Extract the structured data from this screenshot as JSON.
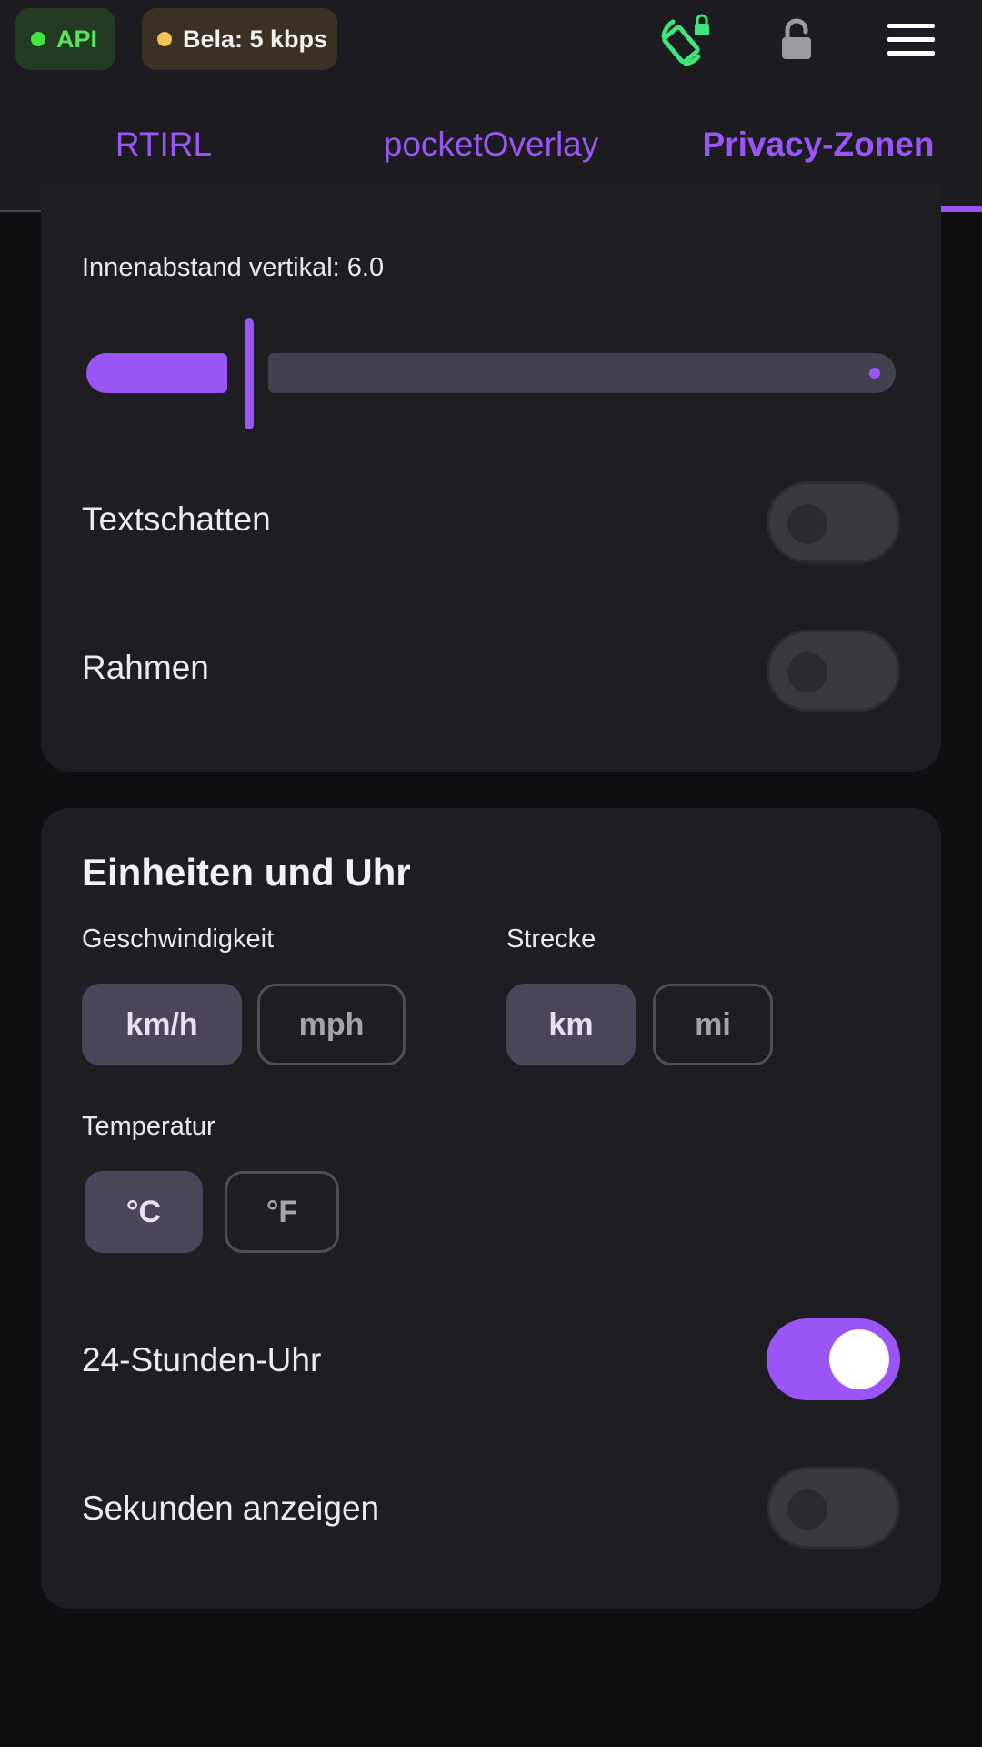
{
  "status": {
    "api_label": "API",
    "bela_label": "Bela: 5 kbps",
    "api_color": "#3ee63e",
    "bela_color": "#f5c35c"
  },
  "toolbar_icons": [
    "screen-rotation-lock-icon",
    "unlock-icon",
    "hamburger-menu-icon"
  ],
  "tabs": [
    {
      "label": "RTIRL",
      "active": false
    },
    {
      "label": "pocketOverlay",
      "active": false
    },
    {
      "label": "Privacy-Zonen",
      "active": true
    }
  ],
  "accent_color": "#9b54f5",
  "display_card": {
    "slider_label": "Innenabstand vertikal: 6.0",
    "slider_value": 6.0,
    "text_shadow": {
      "label": "Textschatten",
      "on": false
    },
    "frame": {
      "label": "Rahmen",
      "on": false
    }
  },
  "units_card": {
    "title": "Einheiten und Uhr",
    "speed": {
      "label": "Geschwindigkeit",
      "options": [
        "km/h",
        "mph"
      ],
      "selected": "km/h"
    },
    "distance": {
      "label": "Strecke",
      "options": [
        "km",
        "mi"
      ],
      "selected": "km"
    },
    "temperature": {
      "label": "Temperatur",
      "options": [
        "°C",
        "°F"
      ],
      "selected": "°C"
    },
    "clock_24h": {
      "label": "24-Stunden-Uhr",
      "on": true
    },
    "show_seconds": {
      "label": "Sekunden anzeigen",
      "on": false
    }
  }
}
